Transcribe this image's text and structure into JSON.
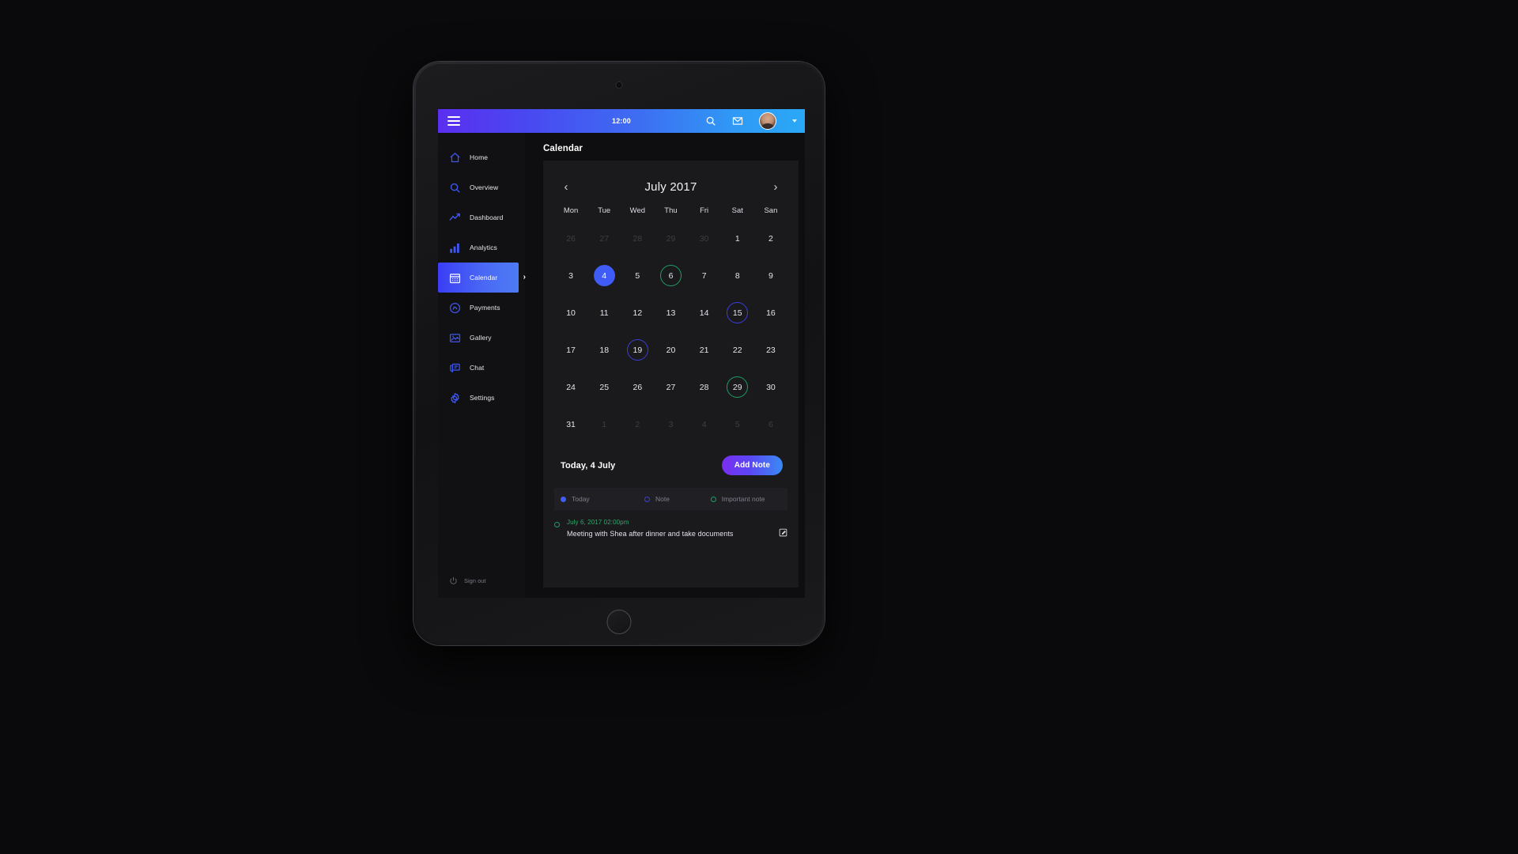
{
  "topbar": {
    "menu_icon": "hamburger-icon",
    "time": "12:00",
    "search_icon": "search-icon",
    "mail_icon": "envelope-icon",
    "avatar": "user-avatar",
    "caret": "chevron-down-icon"
  },
  "sidebar": {
    "items": [
      {
        "label": "Home",
        "icon": "home-icon",
        "active": false
      },
      {
        "label": "Overview",
        "icon": "search-icon",
        "active": false
      },
      {
        "label": "Dashboard",
        "icon": "trending-up-icon",
        "active": false
      },
      {
        "label": "Analytics",
        "icon": "bar-chart-icon",
        "active": false
      },
      {
        "label": "Calendar",
        "icon": "calendar-icon",
        "active": true
      },
      {
        "label": "Payments",
        "icon": "payment-icon",
        "active": false
      },
      {
        "label": "Gallery",
        "icon": "image-icon",
        "active": false
      },
      {
        "label": "Chat",
        "icon": "chat-icon",
        "active": false
      },
      {
        "label": "Settings",
        "icon": "gear-icon",
        "active": false
      }
    ],
    "expand_caret": "›",
    "signout_label": "Sign out",
    "signout_icon": "power-icon"
  },
  "main": {
    "page_title": "Calendar",
    "calendar": {
      "month_title": "July 2017",
      "prev_label": "‹",
      "next_label": "›",
      "weekdays": [
        "Mon",
        "Tue",
        "Wed",
        "Thu",
        "Fri",
        "Sat",
        "San"
      ],
      "days": [
        {
          "n": "26",
          "state": "muted"
        },
        {
          "n": "27",
          "state": "muted"
        },
        {
          "n": "28",
          "state": "muted"
        },
        {
          "n": "29",
          "state": "muted"
        },
        {
          "n": "30",
          "state": "muted"
        },
        {
          "n": "1",
          "state": ""
        },
        {
          "n": "2",
          "state": ""
        },
        {
          "n": "3",
          "state": ""
        },
        {
          "n": "4",
          "state": "today"
        },
        {
          "n": "5",
          "state": ""
        },
        {
          "n": "6",
          "state": "important"
        },
        {
          "n": "7",
          "state": ""
        },
        {
          "n": "8",
          "state": ""
        },
        {
          "n": "9",
          "state": ""
        },
        {
          "n": "10",
          "state": ""
        },
        {
          "n": "11",
          "state": ""
        },
        {
          "n": "12",
          "state": ""
        },
        {
          "n": "13",
          "state": ""
        },
        {
          "n": "14",
          "state": ""
        },
        {
          "n": "15",
          "state": "note"
        },
        {
          "n": "16",
          "state": ""
        },
        {
          "n": "17",
          "state": ""
        },
        {
          "n": "18",
          "state": ""
        },
        {
          "n": "19",
          "state": "note"
        },
        {
          "n": "20",
          "state": ""
        },
        {
          "n": "21",
          "state": ""
        },
        {
          "n": "22",
          "state": ""
        },
        {
          "n": "23",
          "state": ""
        },
        {
          "n": "24",
          "state": ""
        },
        {
          "n": "25",
          "state": ""
        },
        {
          "n": "26",
          "state": ""
        },
        {
          "n": "27",
          "state": ""
        },
        {
          "n": "28",
          "state": ""
        },
        {
          "n": "29",
          "state": "important"
        },
        {
          "n": "30",
          "state": ""
        },
        {
          "n": "31",
          "state": ""
        },
        {
          "n": "1",
          "state": "muted"
        },
        {
          "n": "2",
          "state": "muted"
        },
        {
          "n": "3",
          "state": "muted"
        },
        {
          "n": "4",
          "state": "muted"
        },
        {
          "n": "5",
          "state": "muted"
        },
        {
          "n": "6",
          "state": "muted"
        }
      ]
    },
    "today_label": "Today, 4 July",
    "add_note_label": "Add Note",
    "legend": [
      {
        "label": "Today",
        "marker": "filled-dot",
        "color": "#3f5cf6"
      },
      {
        "label": "Note",
        "marker": "ring-blue",
        "color": "#3b3fd8"
      },
      {
        "label": "Important note",
        "marker": "ring-green",
        "color": "#1f9d62"
      }
    ],
    "note": {
      "marker": "ring-green",
      "time": "July 6, 2017 02:00pm",
      "text": "Meeting with Shea after dinner and take documents",
      "edit_icon": "edit-icon"
    }
  },
  "colors": {
    "accent_purple": "#5b2ff0",
    "accent_blue": "#2aa8f7",
    "today_blue": "#3f5cf6",
    "note_blue": "#3b3fd8",
    "important_green": "#1f9d62",
    "sidebar_icon": "#3f57f2",
    "card_bg": "#1a1a1d",
    "screen_bg": "#0e0e10"
  }
}
